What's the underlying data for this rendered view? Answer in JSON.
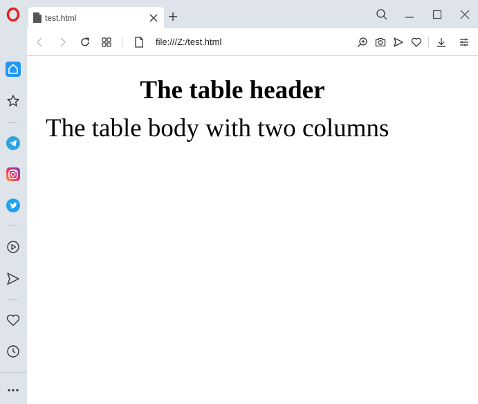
{
  "browser": {
    "tab": {
      "title": "test.html",
      "icon": "page-icon"
    },
    "address": {
      "url": "file:///Z:/test.html"
    },
    "colors": {
      "chrome": "#dfe4ea",
      "opera_red": "#e0201f",
      "home_blue": "#2196f3",
      "telegram": "#2aa3e0",
      "twitter": "#1da1f2"
    }
  },
  "sidebar": {
    "items": [
      {
        "name": "home-icon"
      },
      {
        "name": "star-icon"
      },
      {
        "name": "telegram-icon"
      },
      {
        "name": "instagram-icon"
      },
      {
        "name": "twitter-icon"
      },
      {
        "name": "player-icon"
      },
      {
        "name": "send-icon"
      },
      {
        "name": "heart-icon"
      },
      {
        "name": "clock-icon"
      },
      {
        "name": "more-icon"
      }
    ]
  },
  "page": {
    "header": "The table header",
    "body": "The table body with two columns"
  }
}
